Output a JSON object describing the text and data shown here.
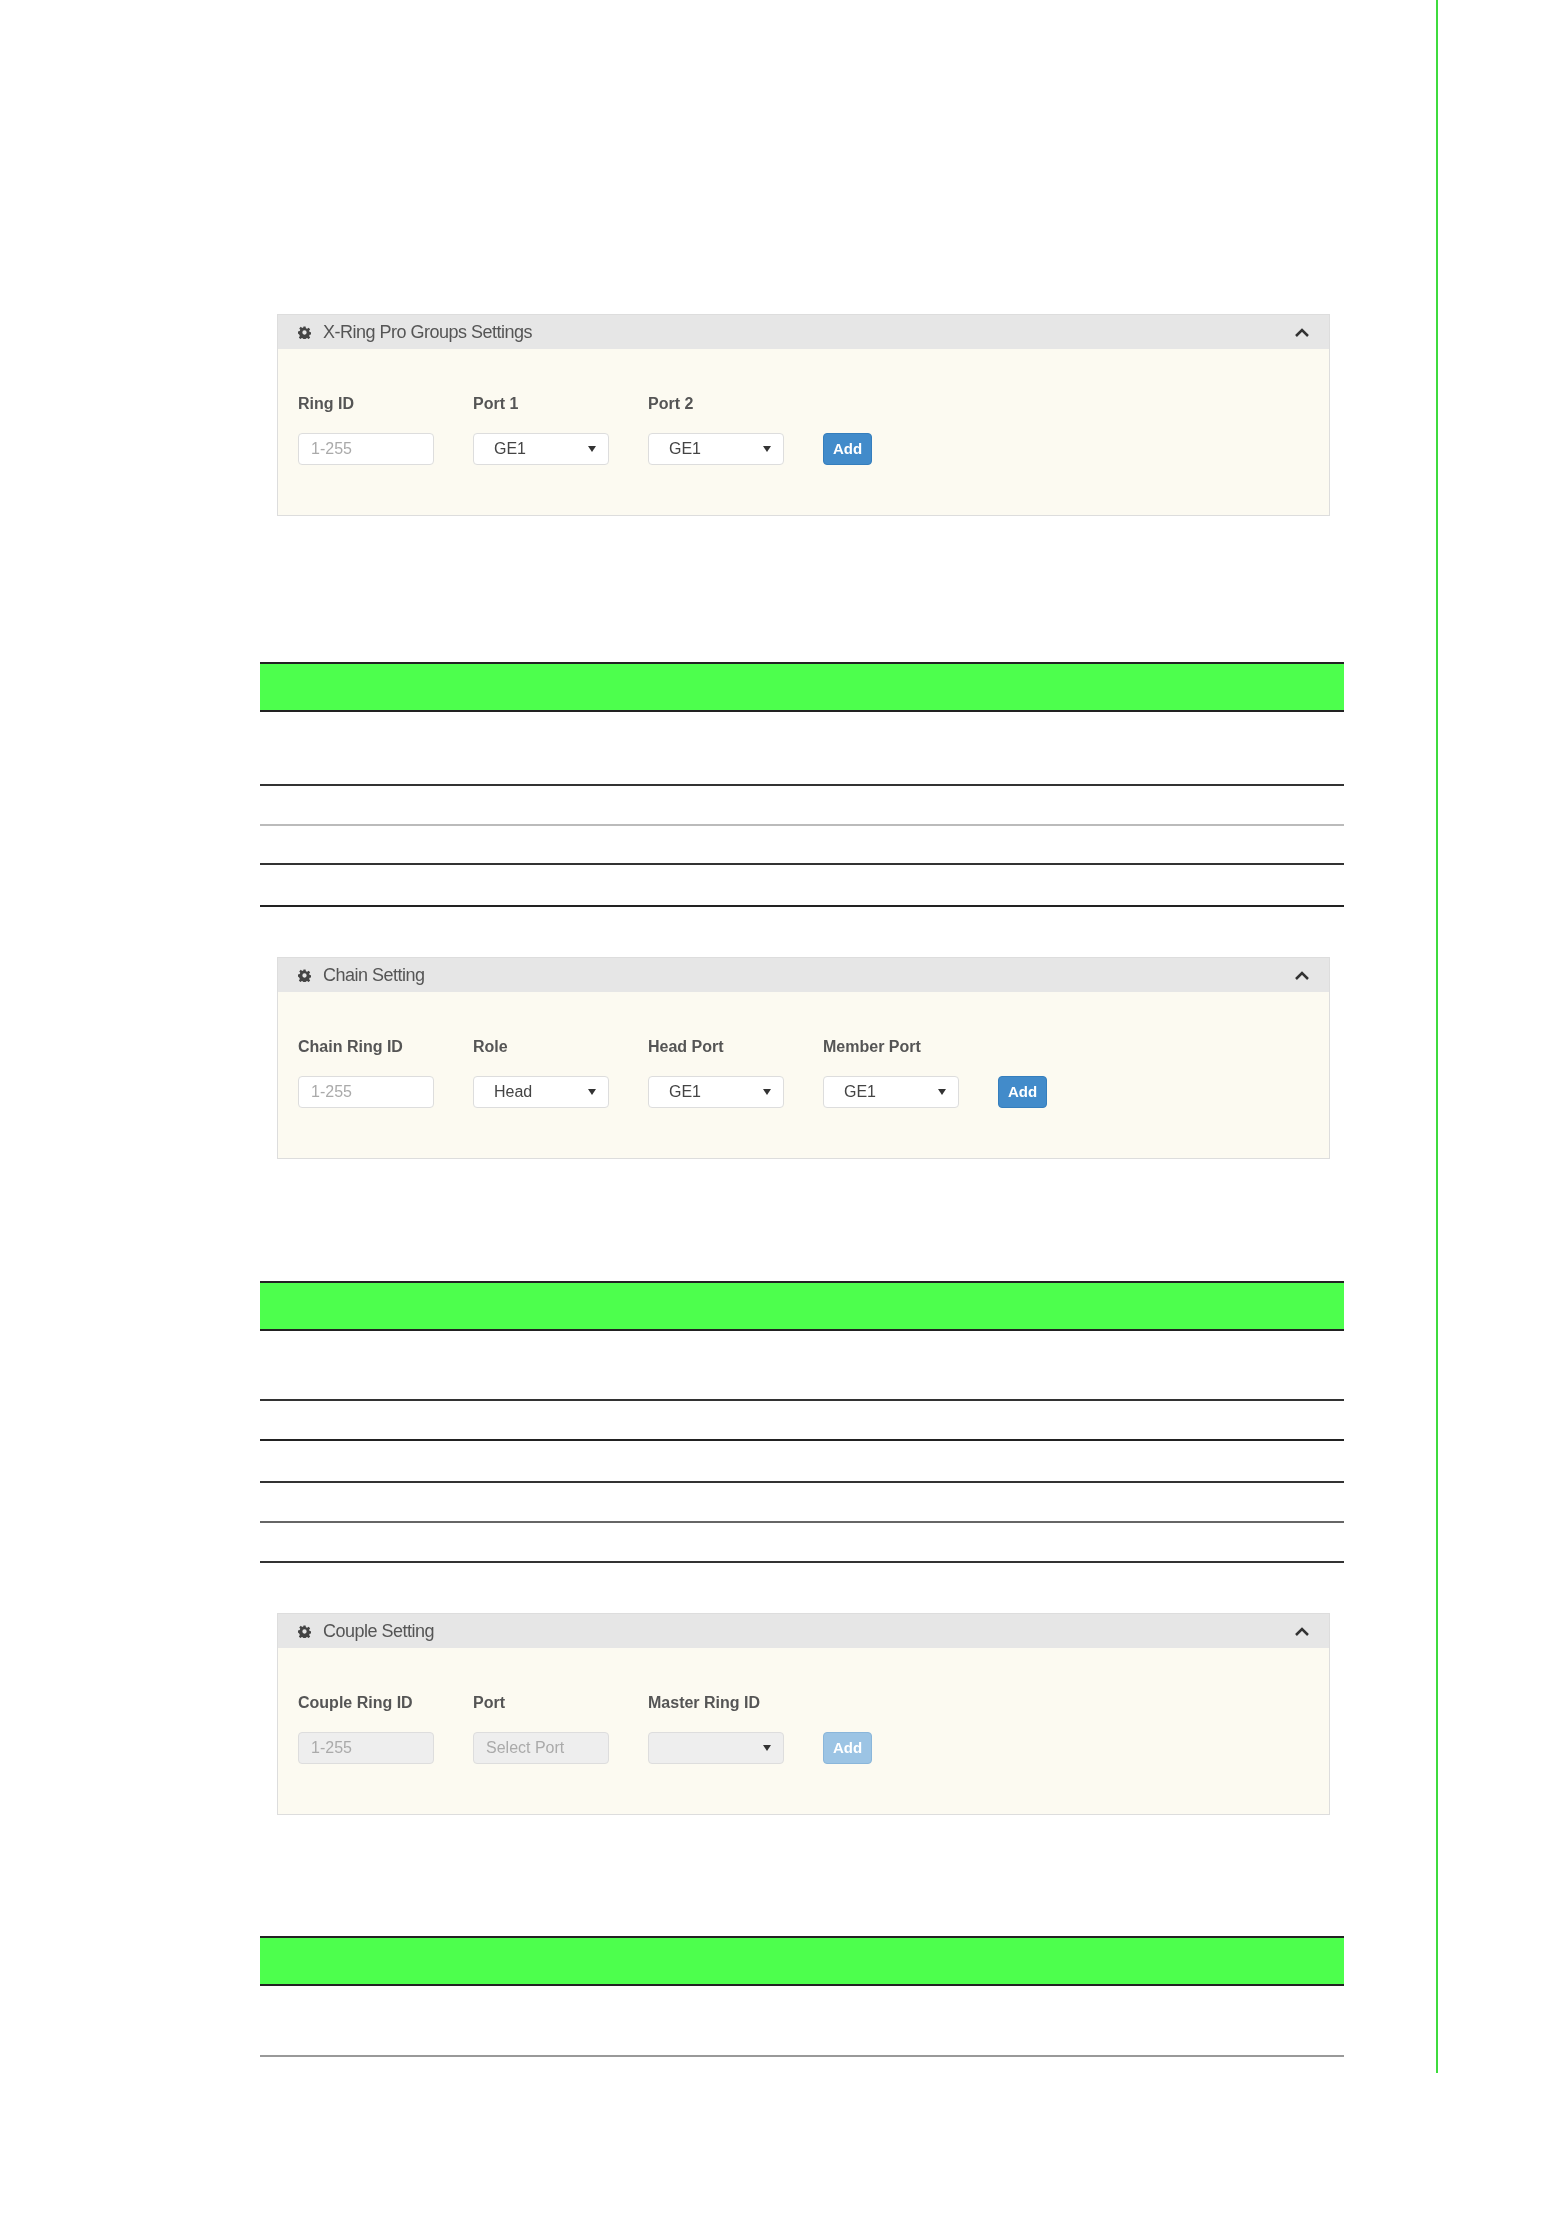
{
  "sections": [
    {
      "panel": {
        "title": "X-Ring Pro Groups Settings",
        "expanded": true,
        "fields": [
          {
            "kind": "input",
            "label": "Ring ID",
            "placeholder": "1-255",
            "disabled": false
          },
          {
            "kind": "select",
            "label": "Port 1",
            "value": "GE1",
            "disabled": false
          },
          {
            "kind": "select",
            "label": "Port 2",
            "value": "GE1",
            "disabled": false
          }
        ],
        "button": {
          "label": "Add",
          "disabled": false
        }
      }
    },
    {
      "panel": {
        "title": "Chain Setting",
        "expanded": true,
        "fields": [
          {
            "kind": "input",
            "label": "Chain Ring ID",
            "placeholder": "1-255",
            "disabled": false
          },
          {
            "kind": "select",
            "label": "Role",
            "value": "Head",
            "disabled": false
          },
          {
            "kind": "select",
            "label": "Head Port",
            "value": "GE1",
            "disabled": false
          },
          {
            "kind": "select",
            "label": "Member Port",
            "value": "GE1",
            "disabled": false
          }
        ],
        "button": {
          "label": "Add",
          "disabled": false
        }
      }
    },
    {
      "panel": {
        "title": "Couple Setting",
        "expanded": true,
        "fields": [
          {
            "kind": "input",
            "label": "Couple Ring ID",
            "placeholder": "1-255",
            "disabled": true
          },
          {
            "kind": "input",
            "label": "Port",
            "placeholder": "Select Port",
            "disabled": true
          },
          {
            "kind": "select",
            "label": "Master Ring ID",
            "disabled": true
          }
        ],
        "button": {
          "label": "Add",
          "disabled": true
        }
      }
    }
  ]
}
